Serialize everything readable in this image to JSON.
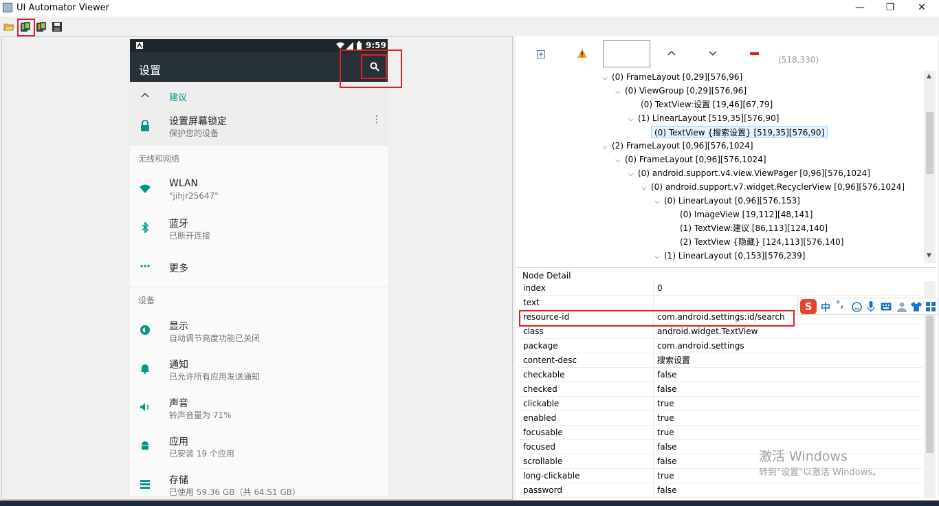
{
  "window": {
    "title": "UI Automator Viewer",
    "minimize": "—",
    "restore": "❐",
    "close": "✕"
  },
  "toolbar": {
    "open_icon": "folder-open-icon",
    "device_screenshot_icon": "device-screenshot-icon",
    "compressed_screenshot_icon": "device-screenshot-compressed-icon",
    "save_icon": "save-icon"
  },
  "phone": {
    "statusbar": {
      "time": "9:59"
    },
    "appbar": {
      "title": "设置"
    },
    "suggestion": {
      "label": "建议"
    },
    "suggestion_item": {
      "title": "设置屏幕锁定",
      "subtitle": "保护您的设备"
    },
    "section_network": "无线和网络",
    "network_items": [
      {
        "title": "WLAN",
        "subtitle": "\"jihjr25647\""
      },
      {
        "title": "蓝牙",
        "subtitle": "已断开连接"
      },
      {
        "title": "更多",
        "subtitle": ""
      }
    ],
    "section_device": "设备",
    "device_items": [
      {
        "title": "显示",
        "subtitle": "自动调节亮度功能已关闭"
      },
      {
        "title": "通知",
        "subtitle": "已允许所有应用发送通知"
      },
      {
        "title": "声音",
        "subtitle": "铃声音量为 71%"
      },
      {
        "title": "应用",
        "subtitle": "已安装 19 个应用"
      },
      {
        "title": "存储",
        "subtitle": "已使用 59.36 GB（共 64.51 GB）"
      }
    ]
  },
  "right": {
    "coords": "(518,330)",
    "tree": [
      "(0) FrameLayout [0,29][576,96]",
      "(0) ViewGroup [0,29][576,96]",
      "(0) TextView:设置 [19,46][67,79]",
      "(1) LinearLayout [519,35][576,90]",
      "(0) TextView {搜索设置} [519,35][576,90]",
      "(2) FrameLayout [0,96][576,1024]",
      "(0) FrameLayout [0,96][576,1024]",
      "(0) android.support.v4.view.ViewPager [0,96][576,1024]",
      "(0) android.support.v7.widget.RecyclerView [0,96][576,1024]",
      "(0) LinearLayout [0,96][576,153]",
      "(0) ImageView [19,112][48,141]",
      "(1) TextView:建议 [86,113][124,140]",
      "(2) TextView {隐藏} [124,113][576,140]",
      "(1) LinearLayout [0,153][576,239]"
    ],
    "detail_title": "Node Detail",
    "detail": [
      {
        "k": "index",
        "v": "0"
      },
      {
        "k": "text",
        "v": ""
      },
      {
        "k": "resource-id",
        "v": "com.android.settings:id/search"
      },
      {
        "k": "class",
        "v": "android.widget.TextView"
      },
      {
        "k": "package",
        "v": "com.android.settings"
      },
      {
        "k": "content-desc",
        "v": "搜索设置"
      },
      {
        "k": "checkable",
        "v": "false"
      },
      {
        "k": "checked",
        "v": "false"
      },
      {
        "k": "clickable",
        "v": "true"
      },
      {
        "k": "enabled",
        "v": "true"
      },
      {
        "k": "focusable",
        "v": "true"
      },
      {
        "k": "focused",
        "v": "false"
      },
      {
        "k": "scrollable",
        "v": "false"
      },
      {
        "k": "long-clickable",
        "v": "true"
      },
      {
        "k": "password",
        "v": "false"
      }
    ]
  },
  "ime_toolbar": {
    "label": "中",
    "punct": "°,"
  },
  "watermark": {
    "line1": "激活 Windows",
    "line2": "转到\"设置\"以激活 Windows。"
  },
  "colors": {
    "accent": "#009688",
    "appbar": "#263238",
    "highlight": "#e02020"
  }
}
